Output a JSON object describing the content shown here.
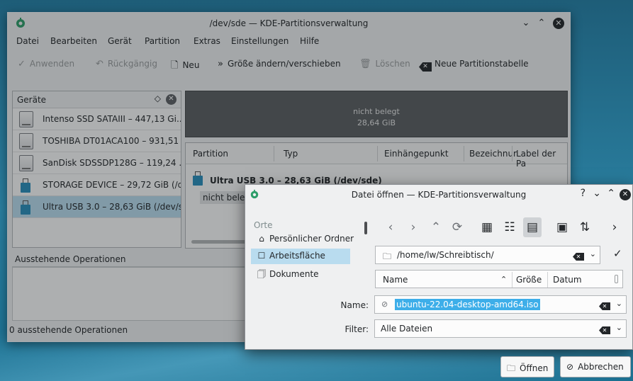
{
  "main": {
    "title": "/dev/sde — KDE-Partitionsverwaltung",
    "menu": [
      "Datei",
      "Bearbeiten",
      "Gerät",
      "Partition",
      "Extras",
      "Einstellungen",
      "Hilfe"
    ],
    "toolbar": {
      "apply": "Anwenden",
      "undo": "Rückgängig",
      "new": "Neu",
      "resize": "Größe ändern/verschieben",
      "delete": "Löschen",
      "new_table": "Neue Partitionstabelle"
    },
    "devices": {
      "title": "Geräte",
      "items": [
        "Intenso SSD SATAIII – 447,13 Gi...",
        "TOSHIBA DT01ACA100 – 931,51 ...",
        "SanDisk SDSSDP128G – 119,24 ...",
        "STORAGE DEVICE – 29,72 GiB (/d...",
        "Ultra USB 3.0 – 28,63 GiB (/dev/s..."
      ],
      "selected_index": 4
    },
    "partition_graphic": {
      "label": "nicht belegt",
      "size": "28,64 GiB"
    },
    "partition_table": {
      "columns": [
        "Partition",
        "Typ",
        "Einhängepunkt",
        "Bezeichnur",
        "Label der Pa"
      ],
      "group": "Ultra USB 3.0 – 28,63 GiB (/dev/sde)",
      "row": "nicht beleg"
    },
    "pending": {
      "title": "Ausstehende Operationen",
      "status": "0 ausstehende Operationen"
    }
  },
  "dialog": {
    "title": "Datei öffnen — KDE-Partitionsverwaltung",
    "places_header": "Orte",
    "places": [
      {
        "label": "Persönlicher Ordner",
        "icon": "home-icon"
      },
      {
        "label": "Arbeitsfläche",
        "icon": "desktop-icon"
      },
      {
        "label": "Dokumente",
        "icon": "documents-icon"
      }
    ],
    "path": "/home/lw/Schreibtisch/",
    "columns": [
      "Name",
      "Größe",
      "Datum"
    ],
    "name_label": "Name:",
    "name_value": "ubuntu-22.04-desktop-amd64.iso",
    "filter_label": "Filter:",
    "filter_value": "Alle Dateien",
    "open_button": "Öffnen",
    "cancel_button": "Abbrechen"
  }
}
